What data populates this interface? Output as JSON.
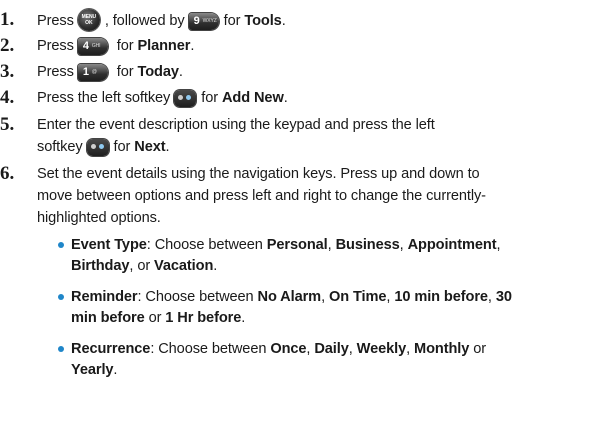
{
  "steps": [
    {
      "num": "1.",
      "press": "Press",
      "sep": ", followed by",
      "for": "for",
      "target": "Tools",
      "end": ".",
      "key1": "menu-ok-key",
      "key2": "nine-key"
    },
    {
      "num": "2.",
      "press": "Press",
      "for": "for",
      "target": "Planner",
      "end": ".",
      "key": "four-key"
    },
    {
      "num": "3.",
      "press": "Press",
      "for": "for",
      "target": "Today",
      "end": ".",
      "key": "one-key"
    },
    {
      "num": "4.",
      "press": "Press the left softkey",
      "for": "for",
      "target": "Add New",
      "end": ".",
      "key": "left-softkey"
    },
    {
      "num": "5.",
      "line1": "Enter the event description using the keypad and press the left",
      "line2a": "softkey",
      "for": "for",
      "target": "Next",
      "end": ".",
      "key": "left-softkey"
    },
    {
      "num": "6.",
      "line1": "Set the event details using the navigation keys. Press up and down to",
      "line2": "move between options and press left and right to change the currently-",
      "line3": "highlighted options."
    }
  ],
  "keys": {
    "menu": {
      "label": "MENU OK"
    },
    "nine": {
      "digit": "9",
      "letters": "WXYZ"
    },
    "four": {
      "digit": "4",
      "letters": "GHI"
    },
    "one": {
      "digit": "1",
      "letters": "@"
    }
  },
  "bullets": [
    {
      "term": "Event Type",
      "text": ": Choose between ",
      "options": [
        "Personal",
        "Business",
        "Appointment",
        "Birthday",
        "Vacation"
      ],
      "sep1": ", ",
      "sep2": ", ",
      "sep3": ",",
      "sep4": ", or ",
      "end": "."
    },
    {
      "term": "Reminder",
      "text": ": Choose between ",
      "options": [
        "No Alarm",
        "On Time",
        "10 min before",
        "30",
        "min before",
        "1 Hr before"
      ],
      "sep1": ", ",
      "sep2": ", ",
      "sep3": ", ",
      "sep5": " or ",
      "end": "."
    },
    {
      "term": "Recurrence",
      "text": ": Choose between ",
      "options": [
        "Once",
        "Daily",
        "Weekly",
        "Monthly",
        "Yearly"
      ],
      "sep1": ", ",
      "sep2": ", ",
      "sep3": ", ",
      "sep4": " or",
      "end": "."
    }
  ],
  "colors": {
    "bullet": "#1f86c9",
    "text": "#1a1a1a"
  }
}
